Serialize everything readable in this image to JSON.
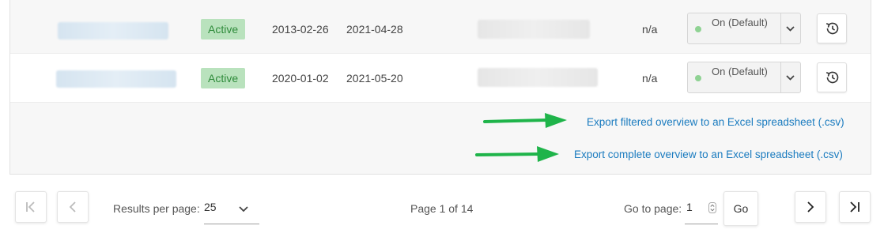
{
  "table": {
    "rows": [
      {
        "status": "Active",
        "start_date": "2013-02-26",
        "end_date": "2021-04-28",
        "value": "n/a",
        "select_value": "On (Default)"
      },
      {
        "status": "Active",
        "start_date": "2020-01-02",
        "end_date": "2021-05-20",
        "value": "n/a",
        "select_value": "On (Default)"
      }
    ]
  },
  "export": {
    "filtered_label": "Export filtered overview to an Excel spreadsheet (.csv)",
    "complete_label": "Export complete overview to an Excel spreadsheet (.csv)"
  },
  "pagination": {
    "results_per_page_label": "Results per page:",
    "results_per_page_value": "25",
    "page_info": "Page 1 of 14",
    "goto_label": "Go to page:",
    "goto_value": "1",
    "go_button": "Go"
  },
  "colors": {
    "status_bg": "#b9e2bd",
    "status_text": "#2e8b3a",
    "select_dot": "#8fd293",
    "link": "#1a7bbf",
    "annotation_arrow": "#1fb44a"
  },
  "icons": {
    "row_action": "history-icon",
    "select_caret": "chevron-down-icon",
    "first_page": "first-page-icon",
    "prev_page": "chevron-left-icon",
    "next_page": "chevron-right-icon",
    "last_page": "last-page-icon",
    "spinner": "stepper-icon"
  }
}
